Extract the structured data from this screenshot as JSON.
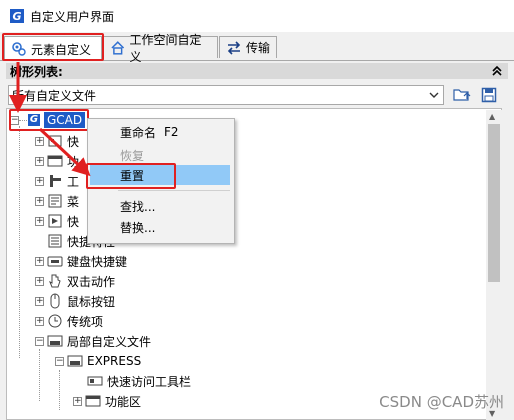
{
  "window": {
    "title": "自定义用户界面",
    "logo_letter": "G"
  },
  "tabs": [
    {
      "label": "元素自定义"
    },
    {
      "label": "工作空间自定义"
    },
    {
      "label": "传输"
    }
  ],
  "panel": {
    "title": "树形列表:"
  },
  "file_select": {
    "value": "所有自定义文件"
  },
  "tree": {
    "root": "GCAD",
    "items": [
      {
        "label": "快"
      },
      {
        "label": "功"
      },
      {
        "label": "工"
      },
      {
        "label": "菜"
      },
      {
        "label": "快"
      },
      {
        "label": "快捷特性"
      },
      {
        "label": "键盘快捷键"
      },
      {
        "label": "双击动作"
      },
      {
        "label": "鼠标按钮"
      },
      {
        "label": "传统项"
      },
      {
        "label": "局部自定义文件"
      },
      {
        "label": "EXPRESS"
      },
      {
        "label": "快速访问工具栏"
      },
      {
        "label": "功能区"
      }
    ]
  },
  "context_menu": {
    "items": [
      {
        "label": "重命名",
        "shortcut": "F2"
      },
      {
        "label": "恢复"
      },
      {
        "label": "重置"
      },
      {
        "label": "查找..."
      },
      {
        "label": "替换..."
      }
    ]
  },
  "watermark": {
    "text": "CSDN @CAD苏州"
  },
  "colors": {
    "highlight_red": "#e02020",
    "selection_blue": "#1e5bc6",
    "menu_hover": "#91c9f7"
  }
}
